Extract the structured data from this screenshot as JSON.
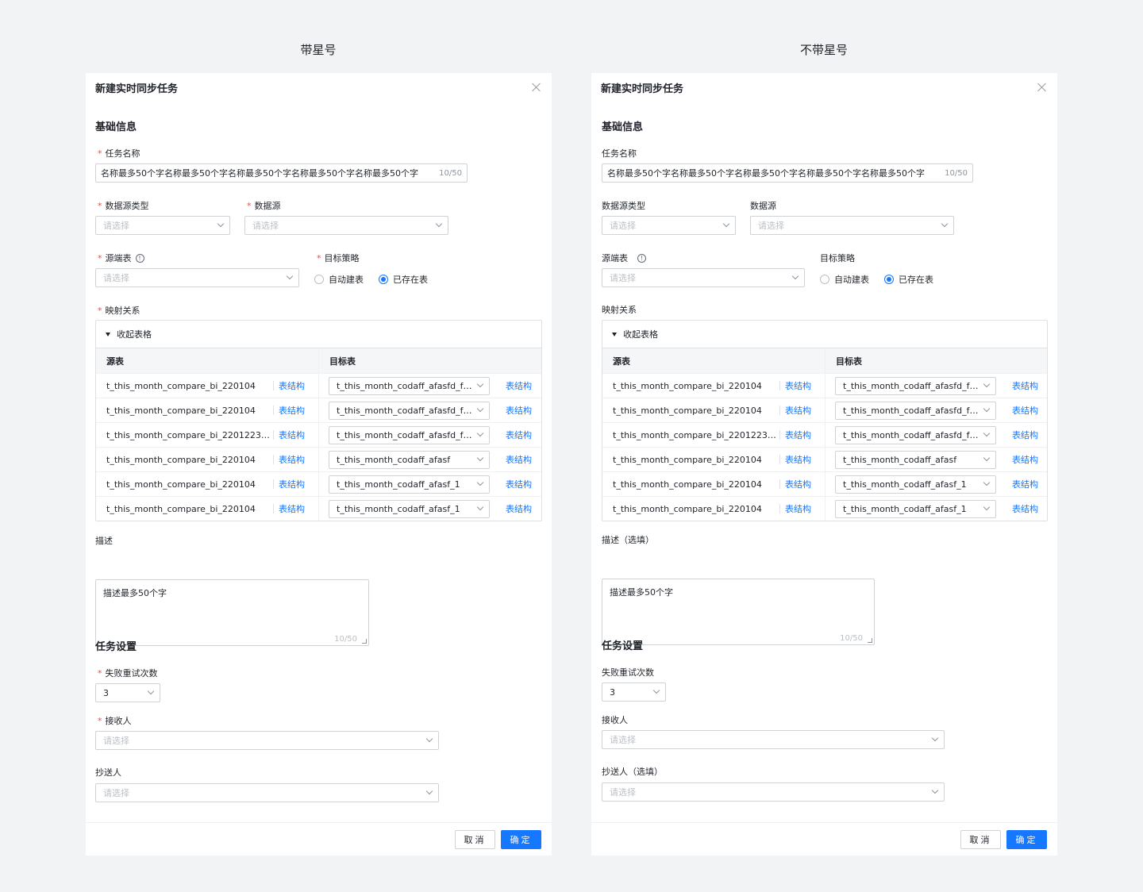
{
  "columns": [
    {
      "caption": "带星号",
      "dialog": {
        "title": "新建实时同步任务",
        "basic_section": "基础信息",
        "task_name_label": "任务名称",
        "task_name_value": "名称最多50个字名称最多50个字名称最多50个字名称最多50个字名称最多50个字",
        "task_name_count": "10/50",
        "datasource_type_label": "数据源类型",
        "datasource_type_placeholder": "请选择",
        "datasource_label": "数据源",
        "datasource_placeholder": "请选择",
        "source_table_label": "源端表",
        "source_table_placeholder": "请选择",
        "target_strategy_label": "目标策略",
        "radio_auto": "自动建表",
        "radio_existing": "已存在表",
        "mapping_label": "映射关系",
        "collapse_label": "收起表格",
        "col_source": "源表",
        "col_target": "目标表",
        "schema_link": "表结构",
        "rows": [
          {
            "src": "t_this_month_compare_bi_220104",
            "tgt": "t_this_month_codaff_afasfd_fd..."
          },
          {
            "src": "t_this_month_compare_bi_220104",
            "tgt": "t_this_month_codaff_afasfd_fd..."
          },
          {
            "src": "t_this_month_compare_bi_220122322...",
            "tgt": "t_this_month_codaff_afasfd_fd..."
          },
          {
            "src": "t_this_month_compare_bi_220104",
            "tgt": "t_this_month_codaff_afasf"
          },
          {
            "src": "t_this_month_compare_bi_220104",
            "tgt": "t_this_month_codaff_afasf_1"
          },
          {
            "src": "t_this_month_compare_bi_220104",
            "tgt": "t_this_month_codaff_afasf_1"
          }
        ],
        "desc_label": "描述",
        "desc_value": "描述最多50个字",
        "desc_count": "10/50",
        "task_section": "任务设置",
        "retry_label": "失败重试次数",
        "retry_value": "3",
        "receiver_label": "接收人",
        "receiver_placeholder": "请选择",
        "cc_label": "抄送人",
        "cc_placeholder": "请选择",
        "cancel_label": "取消",
        "ok_label": "确定"
      }
    },
    {
      "caption": "不带星号",
      "dialog": {
        "title": "新建实时同步任务",
        "basic_section": "基础信息",
        "task_name_label": "任务名称",
        "task_name_value": "名称最多50个字名称最多50个字名称最多50个字名称最多50个字名称最多50个字",
        "task_name_count": "10/50",
        "datasource_type_label": "数据源类型",
        "datasource_type_placeholder": "请选择",
        "datasource_label": "数据源",
        "datasource_placeholder": "请选择",
        "source_table_label": "源端表",
        "source_table_placeholder": "请选择",
        "target_strategy_label": "目标策略",
        "radio_auto": "自动建表",
        "radio_existing": "已存在表",
        "mapping_label": "映射关系",
        "collapse_label": "收起表格",
        "col_source": "源表",
        "col_target": "目标表",
        "schema_link": "表结构",
        "rows": [
          {
            "src": "t_this_month_compare_bi_220104",
            "tgt": "t_this_month_codaff_afasfd_fd..."
          },
          {
            "src": "t_this_month_compare_bi_220104",
            "tgt": "t_this_month_codaff_afasfd_fd..."
          },
          {
            "src": "t_this_month_compare_bi_220122322...",
            "tgt": "t_this_month_codaff_afasfd_fd..."
          },
          {
            "src": "t_this_month_compare_bi_220104",
            "tgt": "t_this_month_codaff_afasf"
          },
          {
            "src": "t_this_month_compare_bi_220104",
            "tgt": "t_this_month_codaff_afasf_1"
          },
          {
            "src": "t_this_month_compare_bi_220104",
            "tgt": "t_this_month_codaff_afasf_1"
          }
        ],
        "desc_label": "描述（选填）",
        "desc_value": "描述最多50个字",
        "desc_count": "10/50",
        "task_section": "任务设置",
        "retry_label": "失败重试次数",
        "retry_value": "3",
        "receiver_label": "接收人",
        "receiver_placeholder": "请选择",
        "cc_label": "抄送人（选填）",
        "cc_placeholder": "请选择",
        "cancel_label": "取消",
        "ok_label": "确定"
      }
    }
  ],
  "required_mark": "*",
  "info_glyph": "!",
  "colors": {
    "primary": "#1677ff",
    "required": "#f54a45"
  }
}
